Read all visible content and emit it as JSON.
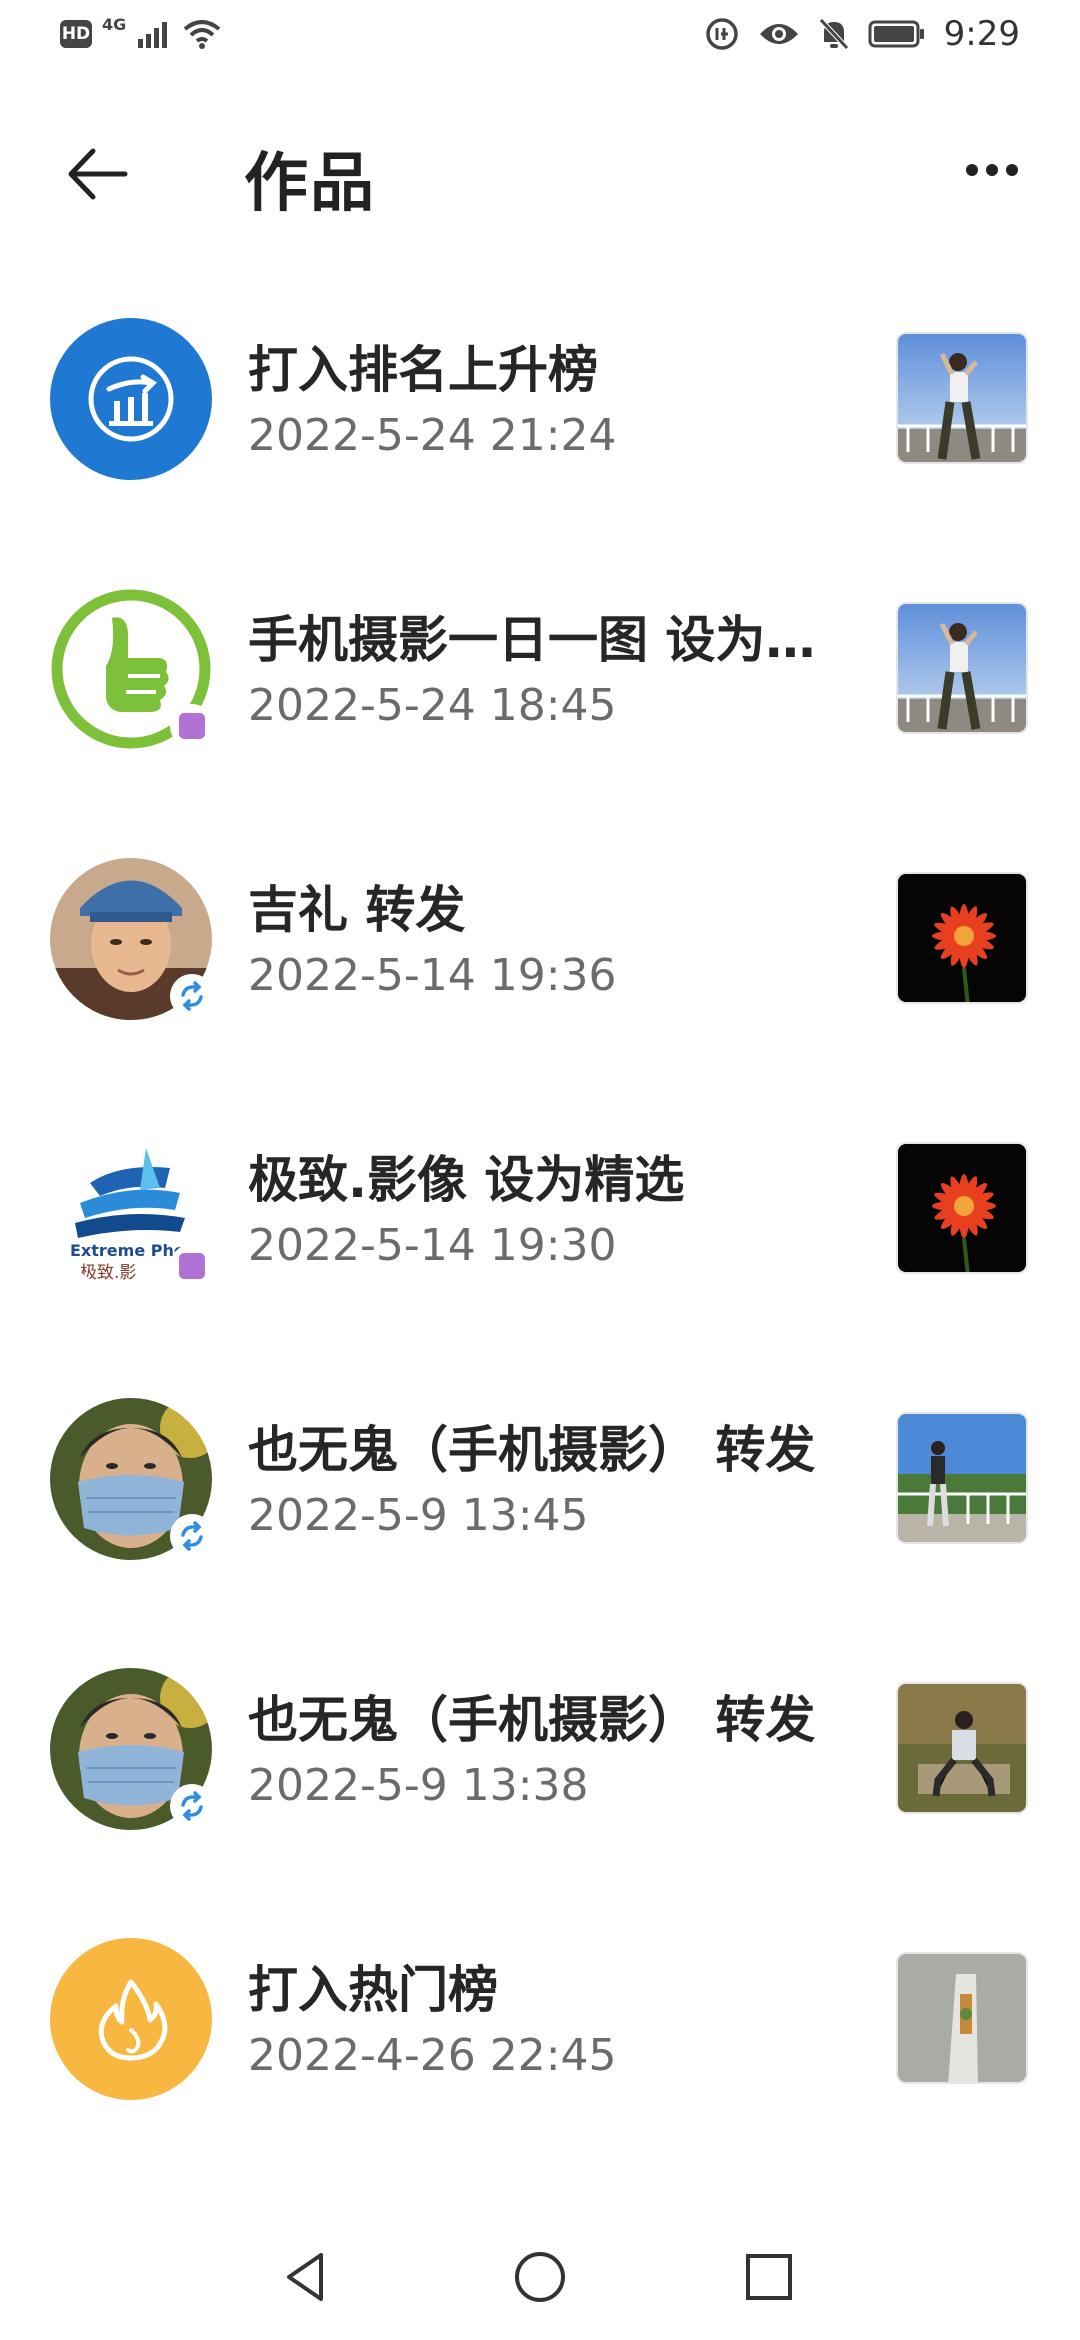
{
  "status_bar": {
    "network_badge": "HD",
    "network_type": "4G",
    "time": "9:29",
    "icons": [
      "hd-icon",
      "signal-icon",
      "wifi-icon",
      "data-saver-icon",
      "eye-icon",
      "bell-off-icon",
      "battery-icon"
    ]
  },
  "header": {
    "title": "作品",
    "back_icon": "back-arrow-icon",
    "more_icon": "more-icon"
  },
  "items": [
    {
      "title": "打入排名上升榜",
      "time": "2022-5-24 21:24",
      "avatar": "ranking-up-icon",
      "badge": ""
    },
    {
      "title": "手机摄影一日一图 设为…",
      "time": "2022-5-24 18:45",
      "avatar": "thumbs-up-logo",
      "badge": "featured-badge"
    },
    {
      "title": "吉礼 转发",
      "time": "2022-5-14 19:36",
      "avatar": "user-avatar-cap",
      "badge": "repost-badge"
    },
    {
      "title": "极致.影像 设为精选",
      "time": "2022-5-14 19:30",
      "avatar": "extreme-photo-logo",
      "badge": "featured-badge"
    },
    {
      "title": "也无鬼（手机摄影） 转发",
      "time": "2022-5-9 13:45",
      "avatar": "user-avatar-mask",
      "badge": "repost-badge"
    },
    {
      "title": "也无鬼（手机摄影） 转发",
      "time": "2022-5-9 13:38",
      "avatar": "user-avatar-mask",
      "badge": "repost-badge"
    },
    {
      "title": "打入热门榜",
      "time": "2022-4-26 22:45",
      "avatar": "hot-flame-icon",
      "badge": ""
    }
  ],
  "avatar_text": {
    "logo_caption": "Extreme Pho",
    "logo_cn": "极致.影"
  },
  "nav_bar": {
    "icons": [
      "nav-back-icon",
      "nav-home-icon",
      "nav-recents-icon"
    ]
  },
  "colors": {
    "rank_blue": "#1f78d1",
    "hot_orange": "#f7b740",
    "green_logo": "#7dc13a",
    "badge_purple": "#b172d8",
    "repost_blue": "#2f8ce0"
  }
}
